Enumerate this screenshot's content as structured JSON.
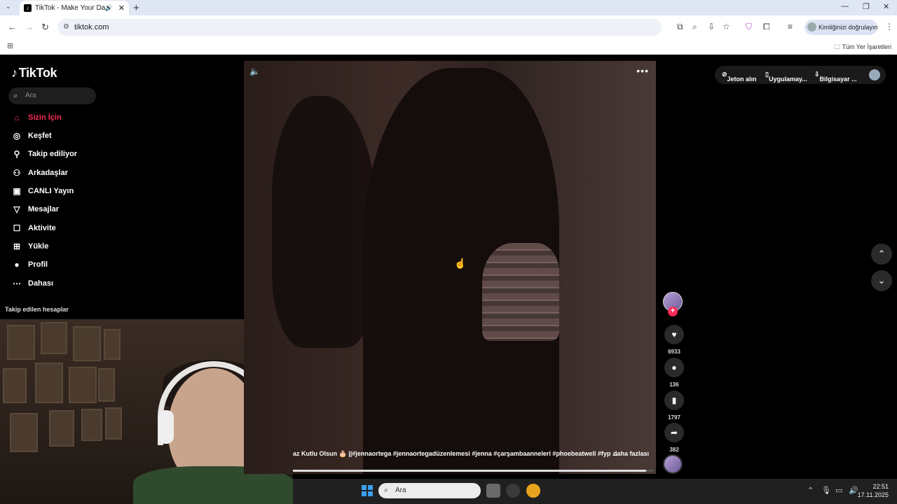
{
  "browser": {
    "tab_title": "TikTok - Make Your Day",
    "new_tab": "+",
    "url": "tiktok.com",
    "profile_label": "Kimliğinizi doğrulayın",
    "bookmarks_label": "Tüm Yer İşaretleri"
  },
  "tiktok": {
    "logo": "TikTok",
    "search_placeholder": "Ara",
    "nav": [
      {
        "label": "Sizin İçin",
        "icon": "home-icon"
      },
      {
        "label": "Keşfet",
        "icon": "compass-icon"
      },
      {
        "label": "Takip ediliyor",
        "icon": "following-icon"
      },
      {
        "label": "Arkadaşlar",
        "icon": "friends-icon"
      },
      {
        "label": "CANLI Yayın",
        "icon": "live-icon"
      },
      {
        "label": "Mesajlar",
        "icon": "messages-icon"
      },
      {
        "label": "Aktivite",
        "icon": "activity-icon"
      },
      {
        "label": "Yükle",
        "icon": "upload-icon"
      },
      {
        "label": "Profil",
        "icon": "profile-icon"
      },
      {
        "label": "Dahası",
        "icon": "more-icon"
      }
    ],
    "following_title": "Takip edilen hesaplar",
    "topbar": {
      "coins": "Jeton alın",
      "app": "Uygulamay...",
      "desktop": "Bilgisayar ..."
    },
    "video": {
      "caption": "az Kutlu Olsun 🎂 ||#jennaortega  #jennaortegadüzenlemesi  #jenna  #çarşambaanneleri  #phoebeatwell  #fyp ...",
      "more": "daha fazlası",
      "progress": 0.98
    },
    "actions": {
      "likes": "6933",
      "comments": "136",
      "saves": "1797",
      "shares": "382"
    }
  },
  "taskbar": {
    "search": "Ara",
    "time": "22:51",
    "date": "17.11.2025"
  }
}
